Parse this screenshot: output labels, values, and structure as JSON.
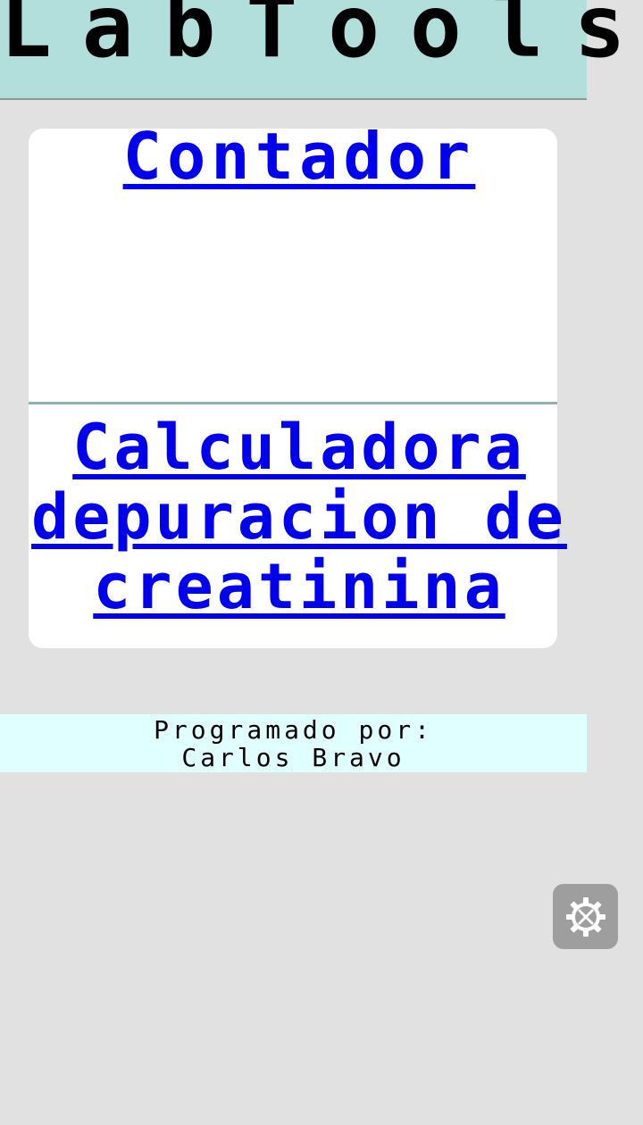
{
  "header": {
    "title": "LabTools"
  },
  "links": {
    "contador": "Contador",
    "calculadora": "Calculadora depuracion de creatinina"
  },
  "footer": {
    "line1": "Programado por:",
    "line2": "Carlos Bravo"
  },
  "settings": {
    "icon": "gear-wrench-icon"
  },
  "colors": {
    "header_bg": "#b2dfdb",
    "page_bg": "#e1e1e1",
    "link": "#0000ee",
    "footer_bg": "#e0ffff"
  }
}
